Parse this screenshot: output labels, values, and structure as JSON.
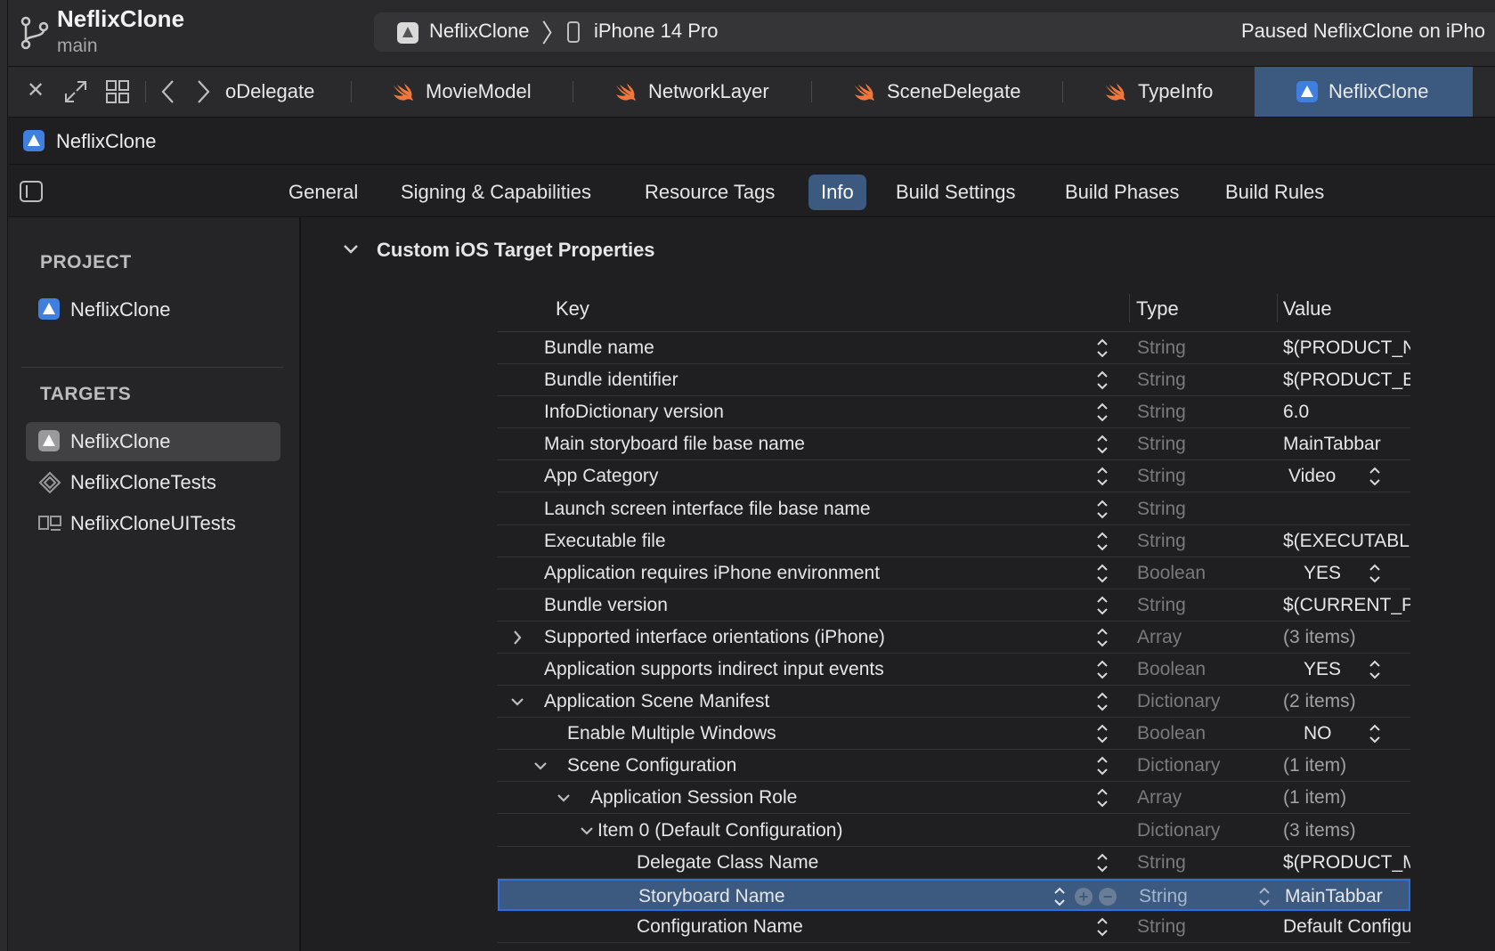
{
  "toolbar": {
    "project_name": "NeflixClone",
    "branch": "main",
    "scheme": "NeflixClone",
    "device": "iPhone 14 Pro",
    "status": "Paused NeflixClone on iPho"
  },
  "tabs": {
    "items": [
      {
        "label": "oDelegate"
      },
      {
        "label": "MovieModel"
      },
      {
        "label": "NetworkLayer"
      },
      {
        "label": "SceneDelegate"
      },
      {
        "label": "TypeInfo"
      },
      {
        "label": "NeflixClone"
      }
    ],
    "active_index": 5
  },
  "breadcrumb": {
    "label": "NeflixClone"
  },
  "editor_tabs": {
    "items": [
      "General",
      "Signing & Capabilities",
      "Resource Tags",
      "Info",
      "Build Settings",
      "Build Phases",
      "Build Rules"
    ],
    "active": "Info"
  },
  "sidebar": {
    "project_header": "PROJECT",
    "project_item": "NeflixClone",
    "targets_header": "TARGETS",
    "targets": [
      {
        "label": "NeflixClone",
        "selected": true
      },
      {
        "label": "NeflixCloneTests",
        "selected": false
      },
      {
        "label": "NeflixCloneUITests",
        "selected": false
      }
    ]
  },
  "section": {
    "title": "Custom iOS Target Properties"
  },
  "table": {
    "columns": {
      "key": "Key",
      "type": "Type",
      "value": "Value"
    },
    "rows": [
      {
        "key": "Bundle name",
        "type": "String",
        "value": "$(PRODUCT_NAME)",
        "indent": 0
      },
      {
        "key": "Bundle identifier",
        "type": "String",
        "value": "$(PRODUCT_BUNDLE_IDENTIFIER)",
        "indent": 0
      },
      {
        "key": "InfoDictionary version",
        "type": "String",
        "value": "6.0",
        "indent": 0
      },
      {
        "key": "Main storyboard file base name",
        "type": "String",
        "value": "MainTabbar",
        "indent": 0
      },
      {
        "key": "App Category",
        "type": "String",
        "value": "Video",
        "indent": 0,
        "value_popup": true
      },
      {
        "key": "Launch screen interface file base name",
        "type": "String",
        "value": "",
        "indent": 0
      },
      {
        "key": "Executable file",
        "type": "String",
        "value": "$(EXECUTABLE_NAME)",
        "indent": 0
      },
      {
        "key": "Application requires iPhone environment",
        "type": "Boolean",
        "value": "YES",
        "indent": 0,
        "value_popup": true
      },
      {
        "key": "Bundle version",
        "type": "String",
        "value": "$(CURRENT_PROJECT_VERSION)",
        "indent": 0
      },
      {
        "key": "Supported interface orientations (iPhone)",
        "type": "Array",
        "value": "(3 items)",
        "indent": 0,
        "disclosure": "collapsed"
      },
      {
        "key": "Application supports indirect input events",
        "type": "Boolean",
        "value": "YES",
        "indent": 0,
        "value_popup": true
      },
      {
        "key": "Application Scene Manifest",
        "type": "Dictionary",
        "value": "(2 items)",
        "indent": 0,
        "disclosure": "expanded"
      },
      {
        "key": "Enable Multiple Windows",
        "type": "Boolean",
        "value": "NO",
        "indent": 1,
        "value_popup": true
      },
      {
        "key": "Scene Configuration",
        "type": "Dictionary",
        "value": "(1 item)",
        "indent": 1,
        "disclosure": "expanded"
      },
      {
        "key": "Application Session Role",
        "type": "Array",
        "value": "(1 item)",
        "indent": 2,
        "disclosure": "expanded"
      },
      {
        "key": "Item 0 (Default Configuration)",
        "type": "Dictionary",
        "value": "(3 items)",
        "indent": 3,
        "disclosure": "expanded",
        "no_stepper": true
      },
      {
        "key": "Delegate Class Name",
        "type": "String",
        "value": "$(PRODUCT_MODULE_NAME).SceneDelegate",
        "indent": 4
      },
      {
        "key": "Storyboard Name",
        "type": "String",
        "value": "MainTabbar",
        "indent": 4,
        "selected": true
      },
      {
        "key": "Configuration Name",
        "type": "String",
        "value": "Default Configuration",
        "indent": 4
      }
    ]
  },
  "colors": {
    "accent": "#3c5a80",
    "selection_border": "#2c6fe0",
    "swift_orange": "#f0763a",
    "project_blue": "#3f7fe0"
  }
}
